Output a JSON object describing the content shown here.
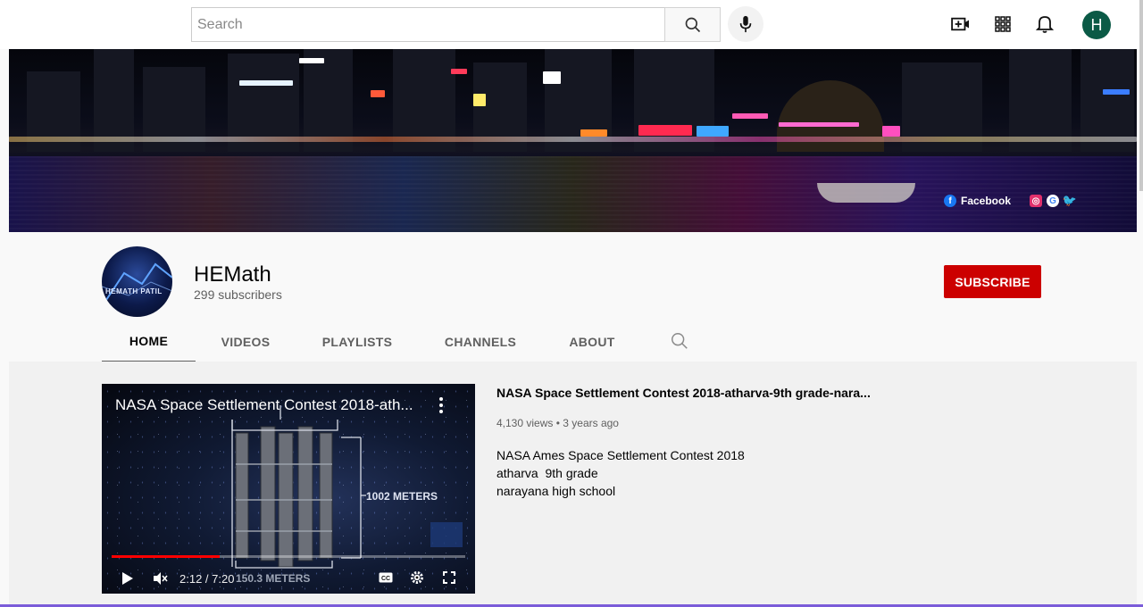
{
  "topbar": {
    "search_placeholder": "Search",
    "icons": [
      "search-icon",
      "mic-icon",
      "create-video-icon",
      "apps-icon",
      "notifications-icon"
    ],
    "avatar_letter": "H"
  },
  "banner": {
    "social_facebook": "Facebook",
    "social_icons": [
      "facebook-icon",
      "instagram-icon",
      "google-icon",
      "twitter-icon"
    ]
  },
  "channel": {
    "name": "HEMath",
    "subscribers": "299 subscribers",
    "subscribe_label": "SUBSCRIBE",
    "avatar_text": "HEMATH PATIL",
    "accent_color": "#cc0000"
  },
  "tabs": [
    {
      "label": "HOME",
      "active": true
    },
    {
      "label": "VIDEOS",
      "active": false
    },
    {
      "label": "PLAYLISTS",
      "active": false
    },
    {
      "label": "CHANNELS",
      "active": false
    },
    {
      "label": "ABOUT",
      "active": false
    }
  ],
  "featured_video": {
    "player_title": "NASA Space Settlement Contest 2018-ath...",
    "title": "NASA Space Settlement Contest 2018-atharva-9th grade-nara...",
    "views": "4,130 views",
    "age": "3 years ago",
    "description": [
      "NASA Ames Space Settlement Contest 2018",
      "atharva  9th grade",
      "narayana high school"
    ],
    "time_display": "2:12 / 7:20",
    "progress_fraction": 0.305,
    "overlay_label_1": "1002 METERS",
    "overlay_label_2": "150.3 METERS"
  }
}
